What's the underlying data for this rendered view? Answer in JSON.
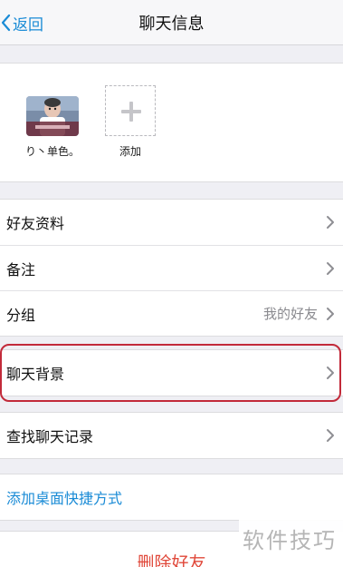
{
  "navbar": {
    "back_label": "返回",
    "title": "聊天信息"
  },
  "members": [
    {
      "name": "り丶单色。"
    },
    {
      "name": "添加"
    }
  ],
  "settings": [
    {
      "label": "好友资料"
    },
    {
      "label": "备注"
    },
    {
      "label": "分组",
      "value": "我的好友"
    }
  ],
  "background": {
    "label": "聊天背景"
  },
  "history": {
    "label": "查找聊天记录"
  },
  "shortcut": {
    "label": "添加桌面快捷方式"
  },
  "delete": {
    "label": "删除好友"
  },
  "watermark": "软件技巧",
  "colors": {
    "accent": "#1a8bd6",
    "danger": "#e0483a",
    "highlight": "#c22a3a"
  }
}
